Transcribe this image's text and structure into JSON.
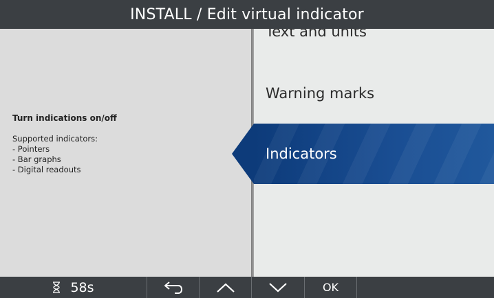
{
  "header": {
    "title": "INSTALL / Edit virtual indicator"
  },
  "help": {
    "heading": "Turn indications on/off",
    "lines": [
      "Supported indicators:",
      "- Pointers",
      "- Bar graphs",
      "- Digital readouts"
    ]
  },
  "menu": {
    "items": [
      {
        "label": "Text and units",
        "state": "partially-visible"
      },
      {
        "label": "Warning marks",
        "state": "normal"
      },
      {
        "label": "Indicators",
        "state": "selected"
      }
    ]
  },
  "toolbar": {
    "timer_icon": "hourglass-icon",
    "timer_text": "58s",
    "back_icon": "back-arrow-icon",
    "up_icon": "chevron-up-icon",
    "down_icon": "chevron-down-icon",
    "ok_label": "OK"
  },
  "colors": {
    "bar": "#3b3f43",
    "left_pane": "#dcdcdc",
    "right_pane": "#e9ebea",
    "selected": "#0d3b7a"
  }
}
